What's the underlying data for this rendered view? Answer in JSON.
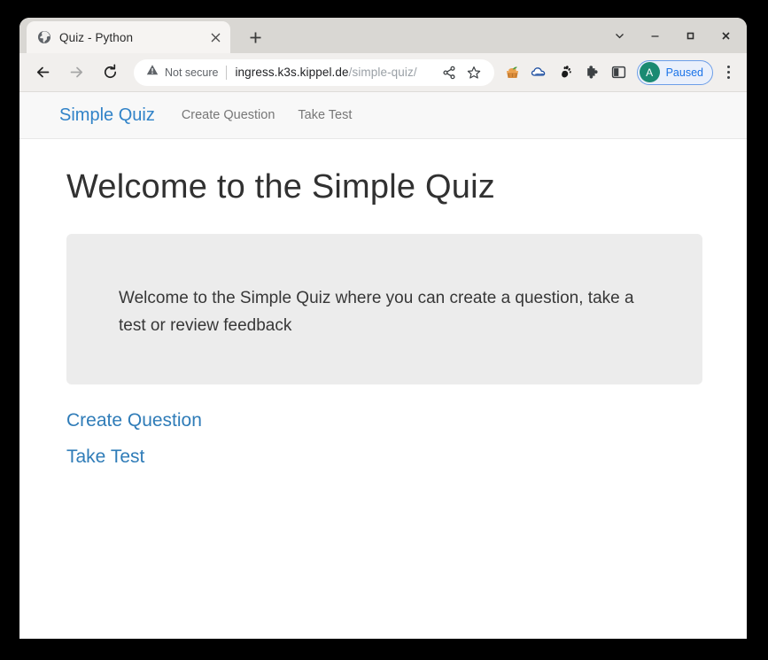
{
  "browser": {
    "tab": {
      "title": "Quiz - Python",
      "favicon_icon": "globe-icon",
      "close_icon": "close-icon"
    },
    "new_tab_label": "+",
    "window_controls": {
      "tab_search_icon": "chevron-down-icon",
      "minimize_icon": "minimize-icon",
      "maximize_icon": "maximize-icon",
      "close_icon": "close-icon"
    },
    "toolbar": {
      "back_icon": "back-arrow-icon",
      "forward_icon": "forward-arrow-icon",
      "reload_icon": "reload-icon",
      "security_icon": "warning-triangle-icon",
      "security_label": "Not secure",
      "url_host": "ingress.k3s.kippel.de",
      "url_path": "/simple-quiz/",
      "share_icon": "share-icon",
      "bookmark_icon": "star-icon",
      "extensions": [
        {
          "name": "basket-extension-icon"
        },
        {
          "name": "cloud-extension-icon"
        },
        {
          "name": "gnome-foot-extension-icon"
        }
      ],
      "puzzle_icon": "puzzle-piece-icon",
      "side_panel_icon": "side-panel-icon",
      "profile": {
        "avatar_initial": "A",
        "status_label": "Paused",
        "avatar_color": "#1a8a72",
        "label_color": "#1a73e8"
      },
      "menu_icon": "three-dot-menu-icon"
    }
  },
  "site": {
    "navbar": {
      "brand": "Simple Quiz",
      "brand_color": "#3183c8",
      "links": [
        {
          "label": "Create Question"
        },
        {
          "label": "Take Test"
        }
      ]
    },
    "main": {
      "title": "Welcome to the Simple Quiz",
      "jumbotron_text": "Welcome to the Simple Quiz where you can create a question, take a test or review feedback",
      "jumbotron_bg": "#ececec",
      "links": [
        {
          "label": "Create Question"
        },
        {
          "label": "Take Test"
        }
      ],
      "link_color": "#2f7cb8"
    }
  }
}
